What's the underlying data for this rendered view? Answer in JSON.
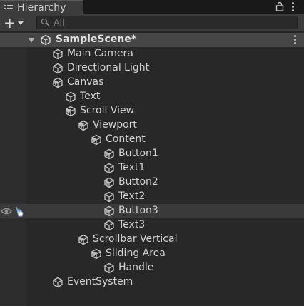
{
  "panel": {
    "tab_title": "Hierarchy",
    "tab_icon": "list-icon",
    "lock_icon": "lock-icon",
    "menu_icon": "kebab-menu-icon"
  },
  "toolbar": {
    "add_label": "+",
    "search_placeholder": "All",
    "search_value": ""
  },
  "scene": {
    "name": "SampleScene*",
    "expanded": true,
    "icon": "unity-scene-icon"
  },
  "tree": [
    {
      "label": "Main Camera",
      "depth": 0,
      "foldout": "none",
      "icon": "cube-icon"
    },
    {
      "label": "Directional Light",
      "depth": 0,
      "foldout": "none",
      "icon": "cube-icon"
    },
    {
      "label": "Canvas",
      "depth": 0,
      "foldout": "expanded",
      "icon": "cube-icon"
    },
    {
      "label": "Text",
      "depth": 1,
      "foldout": "none",
      "icon": "cube-icon"
    },
    {
      "label": "Scroll View",
      "depth": 1,
      "foldout": "expanded",
      "icon": "cube-icon"
    },
    {
      "label": "Viewport",
      "depth": 2,
      "foldout": "expanded",
      "icon": "cube-icon"
    },
    {
      "label": "Content",
      "depth": 3,
      "foldout": "expanded",
      "icon": "cube-icon"
    },
    {
      "label": "Button1",
      "depth": 4,
      "foldout": "collapsed",
      "icon": "cube-icon"
    },
    {
      "label": "Text1",
      "depth": 4,
      "foldout": "none",
      "icon": "cube-icon"
    },
    {
      "label": "Button2",
      "depth": 4,
      "foldout": "collapsed",
      "icon": "cube-icon"
    },
    {
      "label": "Text2",
      "depth": 4,
      "foldout": "none",
      "icon": "cube-icon"
    },
    {
      "label": "Button3",
      "depth": 4,
      "foldout": "collapsed",
      "icon": "cube-icon",
      "hovered": true,
      "visibility": "eye-icon",
      "picking": "hand-pointer-icon"
    },
    {
      "label": "Text3",
      "depth": 4,
      "foldout": "none",
      "icon": "cube-icon"
    },
    {
      "label": "Scrollbar Vertical",
      "depth": 2,
      "foldout": "expanded",
      "icon": "cube-icon"
    },
    {
      "label": "Sliding Area",
      "depth": 3,
      "foldout": "expanded",
      "icon": "cube-icon"
    },
    {
      "label": "Handle",
      "depth": 4,
      "foldout": "none",
      "icon": "cube-icon"
    },
    {
      "label": "EventSystem",
      "depth": 0,
      "foldout": "none",
      "icon": "cube-icon"
    }
  ],
  "colors": {
    "panel_bg": "#282828",
    "tab_bg": "#3c3c3c",
    "scene_header_bg": "#464646",
    "hover_row_bg": "#3a3a3a",
    "text": "#d2d2d2",
    "hand_icon": "#7fb2f0"
  }
}
